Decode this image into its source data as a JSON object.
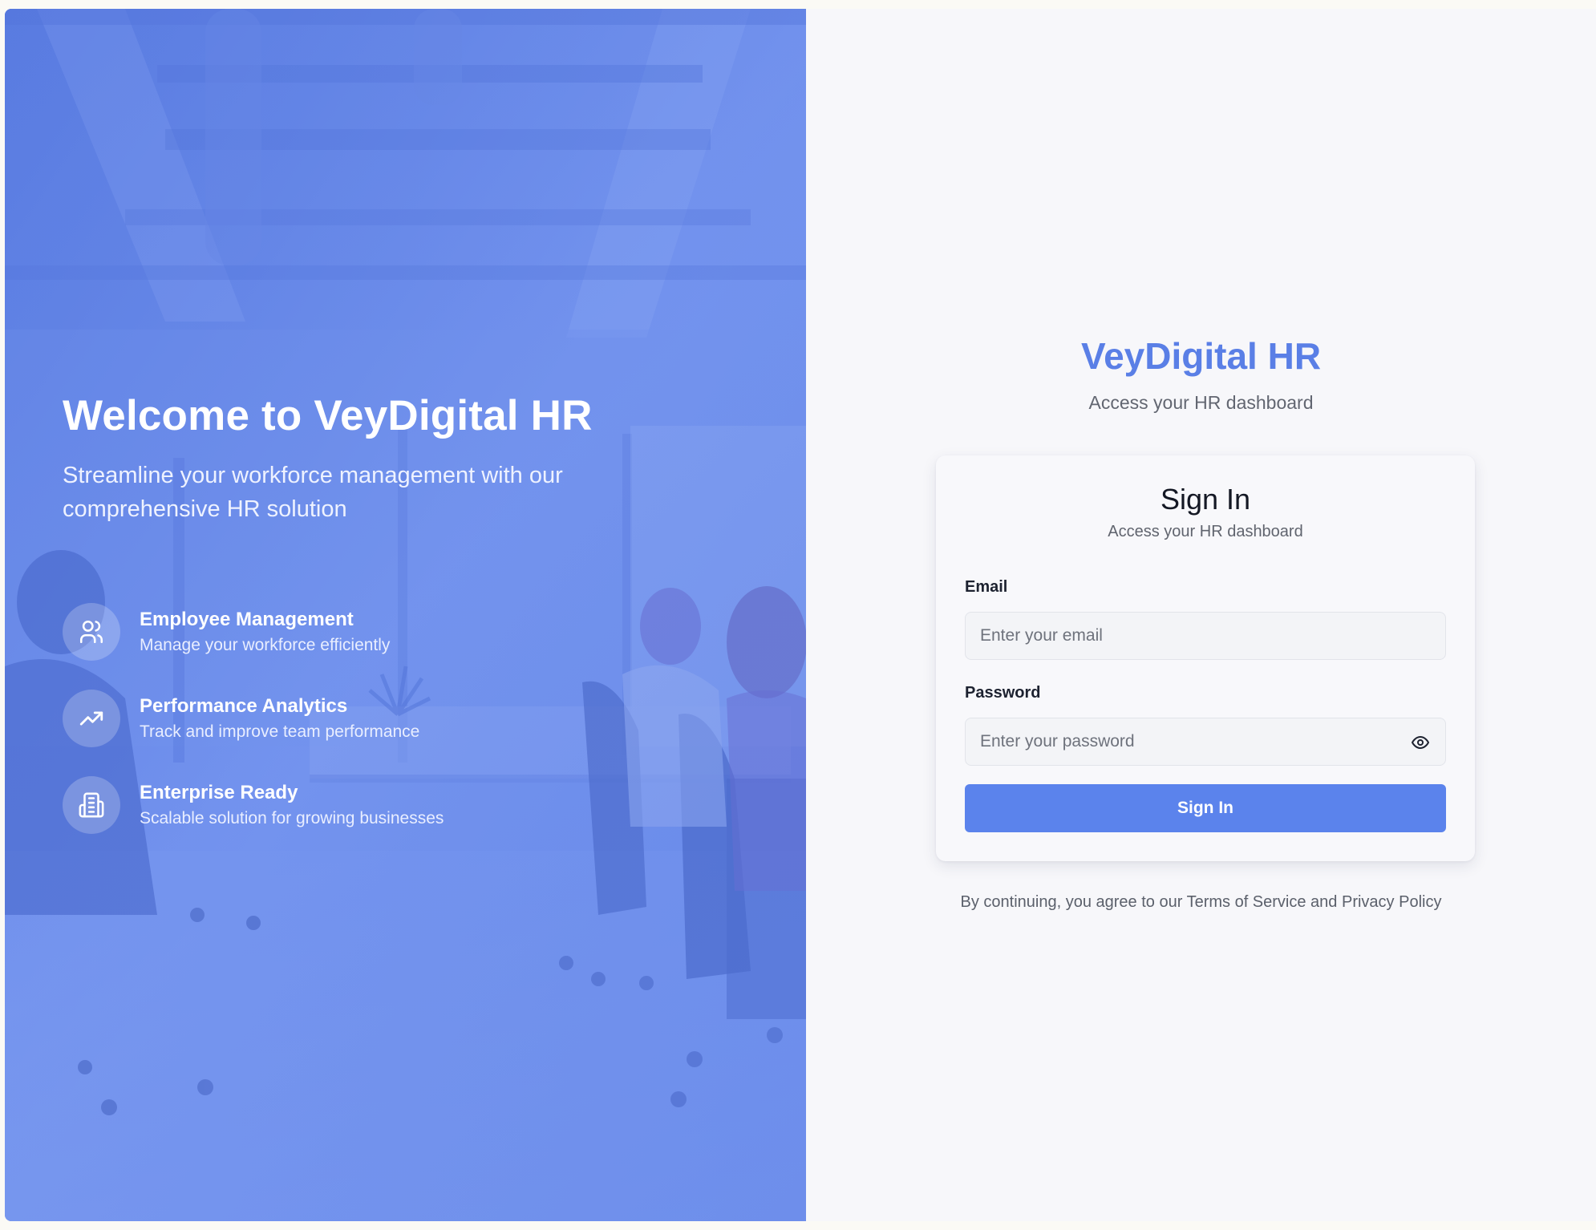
{
  "hero": {
    "title": "Welcome to VeyDigital HR",
    "subtitle": "Streamline your workforce management with our comprehensive HR solution",
    "features": [
      {
        "icon": "users-icon",
        "title": "Employee Management",
        "description": "Manage your workforce efficiently"
      },
      {
        "icon": "trending-up-icon",
        "title": "Performance Analytics",
        "description": "Track and improve team performance"
      },
      {
        "icon": "building-icon",
        "title": "Enterprise Ready",
        "description": "Scalable solution for growing businesses"
      }
    ]
  },
  "auth": {
    "brand": "VeyDigital HR",
    "brand_subtitle": "Access your HR dashboard",
    "card": {
      "title": "Sign In",
      "subtitle": "Access your HR dashboard",
      "email_label": "Email",
      "email_placeholder": "Enter your email",
      "password_label": "Password",
      "password_placeholder": "Enter your password",
      "toggle_icon": "eye-icon",
      "submit_label": "Sign In"
    },
    "legal": "By continuing, you agree to our Terms of Service and Privacy Policy"
  },
  "colors": {
    "brand": "#5a7fe6",
    "button": "#5b83ec",
    "hero_tint": "#6f8fe6"
  }
}
